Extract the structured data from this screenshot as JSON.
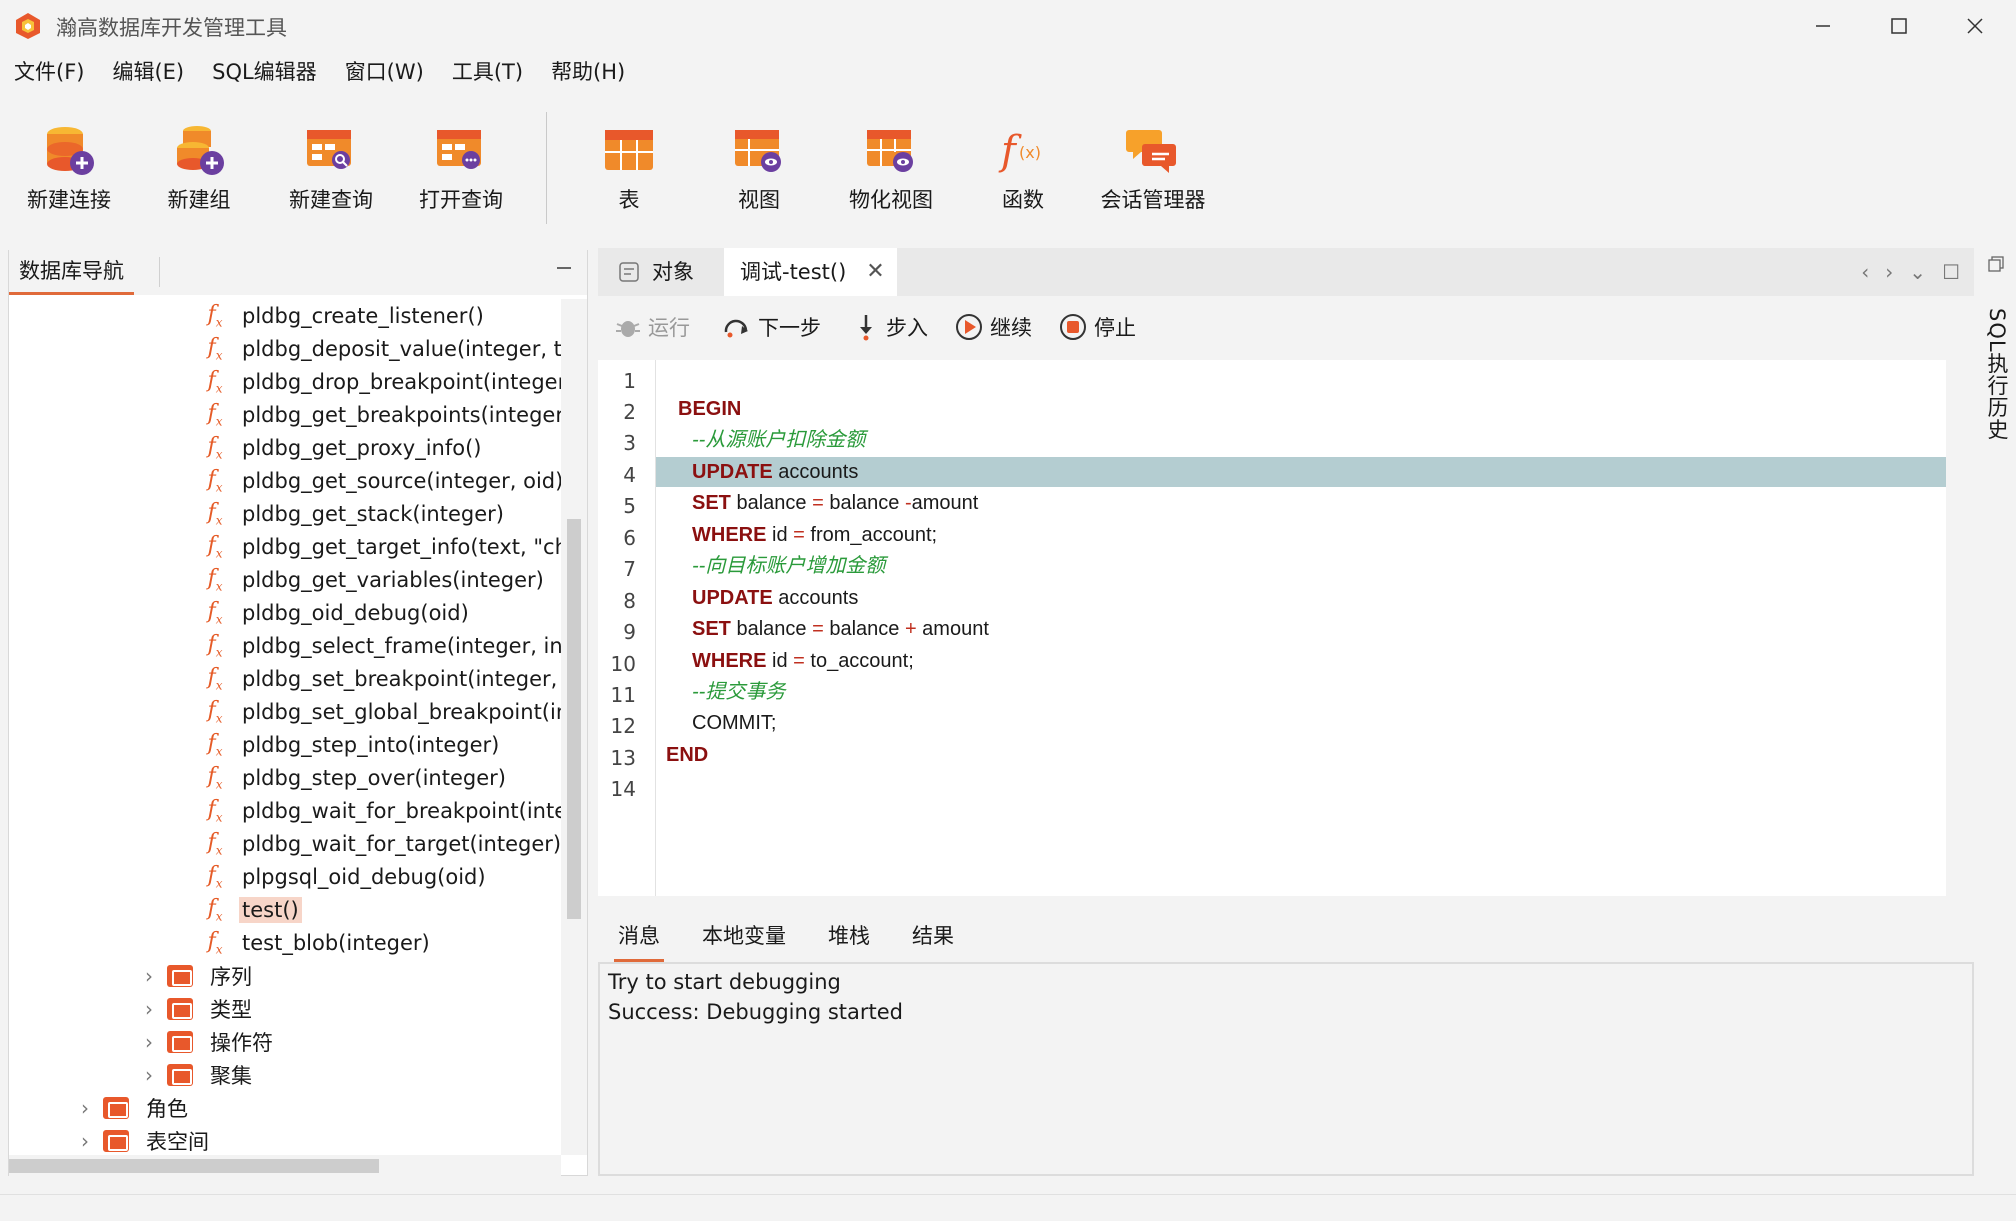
{
  "window": {
    "title": "瀚高数据库开发管理工具"
  },
  "menu": [
    "文件(F)",
    "编辑(E)",
    "SQL编辑器",
    "窗口(W)",
    "工具(T)",
    "帮助(H)"
  ],
  "toolbar": {
    "new_connection": "新建连接",
    "new_group": "新建组",
    "new_query": "新建查询",
    "open_query": "打开查询",
    "table": "表",
    "view": "视图",
    "materialized_view": "物化视图",
    "function": "函数",
    "session_manager": "会话管理器"
  },
  "nav": {
    "tab": "数据库导航",
    "functions": [
      "pldbg_create_listener()",
      "pldbg_deposit_value(integer, te:",
      "pldbg_drop_breakpoint(integer,",
      "pldbg_get_breakpoints(integer)",
      "pldbg_get_proxy_info()",
      "pldbg_get_source(integer, oid)",
      "pldbg_get_stack(integer)",
      "pldbg_get_target_info(text, \"cha",
      "pldbg_get_variables(integer)",
      "pldbg_oid_debug(oid)",
      "pldbg_select_frame(integer, inte",
      "pldbg_set_breakpoint(integer, o",
      "pldbg_set_global_breakpoint(int",
      "pldbg_step_into(integer)",
      "pldbg_step_over(integer)",
      "pldbg_wait_for_breakpoint(integ",
      "pldbg_wait_for_target(integer)",
      "plpgsql_oid_debug(oid)",
      "test()",
      "test_blob(integer)"
    ],
    "folders": [
      "序列",
      "类型",
      "操作符",
      "聚集"
    ],
    "top_folders": [
      "角色",
      "表空间"
    ]
  },
  "editor": {
    "tab_objects": "对象",
    "tab_debug": "调试-test()",
    "debug": {
      "run": "运行",
      "step_over": "下一步",
      "step_into": "步入",
      "continue": "继续",
      "stop": "停止"
    },
    "line_numbers": [
      "1",
      "2",
      "3",
      "4",
      "5",
      "6",
      "7",
      "8",
      "9",
      "10",
      "11",
      "12",
      "13",
      "14"
    ]
  },
  "code": {
    "l2_kw": "BEGIN",
    "l3_cm": "--从源账户扣除金额",
    "l4_kw": "UPDATE",
    "l4_tx": " accounts",
    "l5_kw": "SET",
    "l5_tx": " balance ",
    "l5_op": "=",
    "l5_tx2": " balance ",
    "l5_op2": "-",
    "l5_tx3": "amount",
    "l6_kw": "WHERE",
    "l6_tx": " id ",
    "l6_op": "=",
    "l6_tx2": " from_account;",
    "l7_cm": "--向目标账户增加金额",
    "l8_kw": "UPDATE",
    "l8_tx": " accounts",
    "l9_kw": "SET",
    "l9_tx": " balance ",
    "l9_op": "=",
    "l9_tx2": " balance ",
    "l9_op2": "+",
    "l9_tx3": " amount",
    "l10_kw": "WHERE",
    "l10_tx": " id ",
    "l10_op": "=",
    "l10_tx2": " to_account;",
    "l11_cm": "--提交事务",
    "l12_tx": "COMMIT;",
    "l13_kw": "END"
  },
  "bottom": {
    "tabs": [
      "消息",
      "本地变量",
      "堆栈",
      "结果"
    ],
    "messages": [
      "Try to start debugging",
      "Success: Debugging started"
    ]
  },
  "right_rail": {
    "label": "SQL执行历史"
  },
  "colors": {
    "accent": "#e06a3a",
    "keyword": "#8b1010",
    "comment": "#2a9a3a",
    "highlight": "#b4cdd1"
  }
}
